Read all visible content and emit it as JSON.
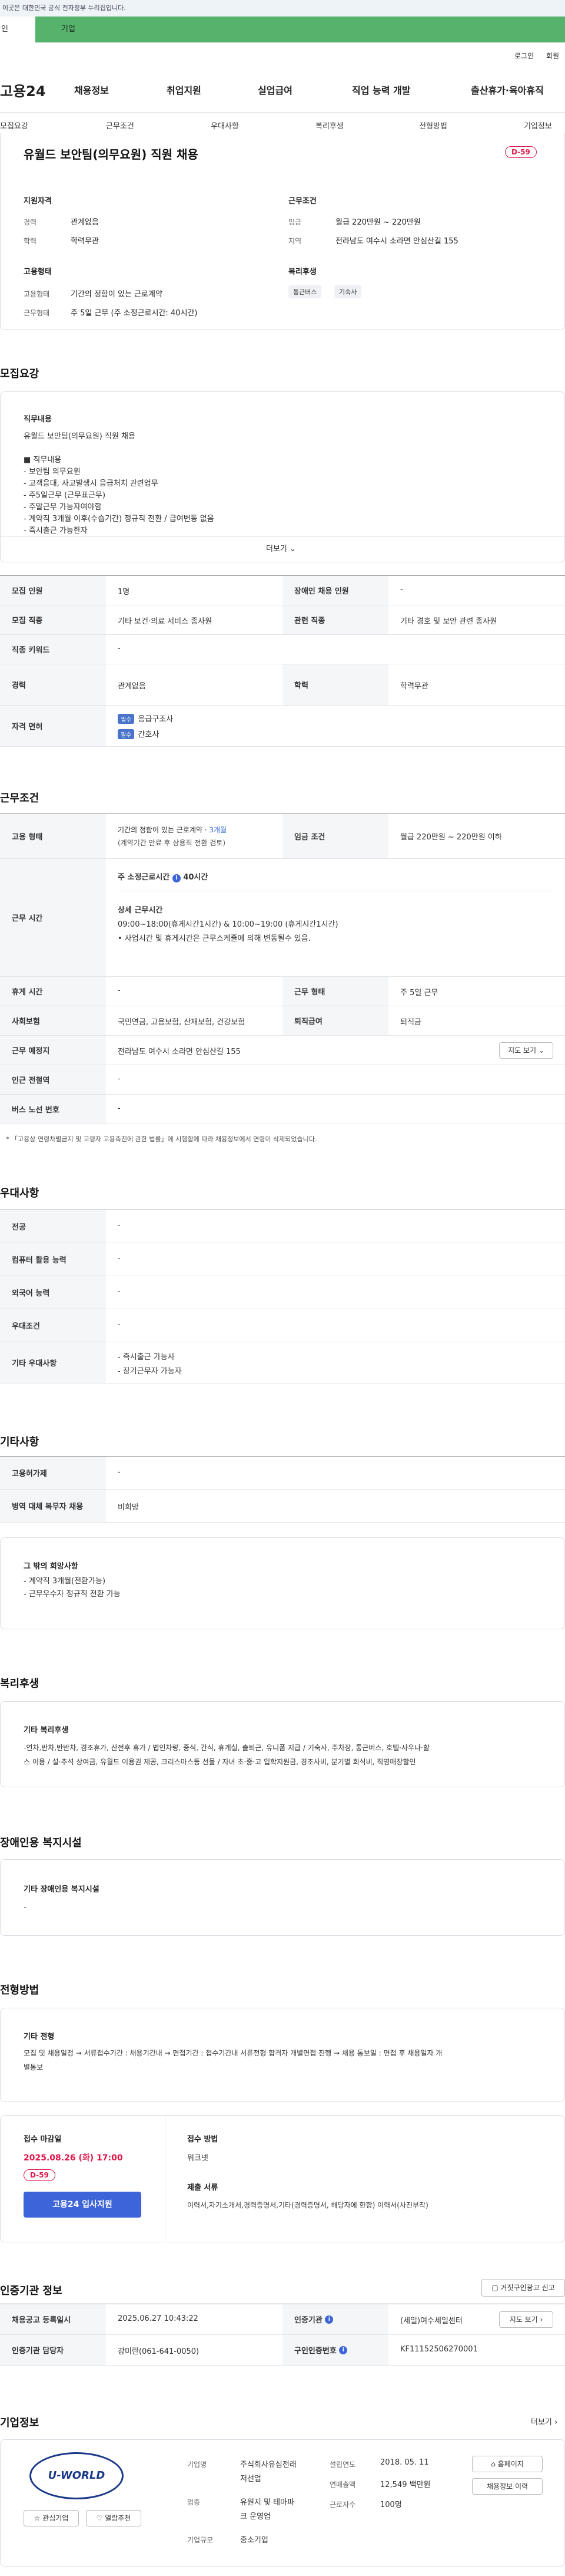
{
  "gov": "이곳은 대한민국 공식 전자정부 누리집입니다.",
  "tabs": [
    "인",
    "기업"
  ],
  "util": {
    "login": "로그인",
    "join": "회원"
  },
  "logo": "고용24",
  "gnb": [
    "채용정보",
    "취업지원",
    "실업급여",
    "직업 능력 개발",
    "출산휴가·육아휴직"
  ],
  "snb": [
    "모집요강",
    "근무조건",
    "우대사항",
    "복리후생",
    "전형방법",
    "기업정보"
  ],
  "job": {
    "title": "유월드 보안팀(의무요원) 직원 채용",
    "dday": "D-59",
    "qual_title": "지원자격",
    "career_k": "경력",
    "career_v": "관계없음",
    "edu_k": "학력",
    "edu_v": "학력무관",
    "emp_title": "고용형태",
    "emp_k": "고용형태",
    "emp_v": "기간의 정함이 있는 근로계약",
    "hours_k": "근무형태",
    "hours_v": "주 5일 근무 (주 소정근로시간: 40시간)",
    "cond_title": "근무조건",
    "wage_k": "임금",
    "wage_v": "월급 220만원 ~ 220만원",
    "area_k": "지역",
    "area_v": "전라남도 여수시 소라면 안심산길 155",
    "ben_title": "복리후생",
    "chips": [
      "통근버스",
      "기숙사"
    ]
  },
  "recruit": {
    "title": "모집요강",
    "box_title": "직무내용",
    "lines": [
      "유월드 보안팀(의무요원) 직원 채용",
      "",
      "■ 직무내용",
      "- 보안팀 의무요원",
      "- 고객응대, 사고발생시 응급처치 관련업무",
      "- 주5일근무 (근무표근무)",
      "- 주말근무 가능자여야함",
      "- 계약직 3개월 이후(수습기간) 정규직 전환 / 급여변동 없음",
      "- 즉시출근 가능한자"
    ],
    "more": "더보기"
  },
  "rtable": {
    "r1": [
      "모집 인원",
      "1명",
      "장애인 채용 인원",
      "-"
    ],
    "r2": [
      "모집 직종",
      "기타 보건·의료 서비스 종사원",
      "관련 직종",
      "기타 경호 및 보안 관련 종사원"
    ],
    "r3": [
      "직종 키워드",
      "-"
    ],
    "r4": [
      "경력",
      "관계없음",
      "학력",
      "학력무관"
    ],
    "r5": [
      "자격 면허"
    ],
    "tag": "필수",
    "lic": [
      "응급구조사",
      "간호사"
    ]
  },
  "work": {
    "title": "근무조건",
    "emp_k": "고용 형태",
    "emp_v": "기간의 정함이 있는 근로계약 · ",
    "emp_month": "3개월",
    "emp_v2": "(계약기간 만료 후 상용직 전환 검토)",
    "wage_k": "임금 조건",
    "wage_v": "월급 220만원 ~ 220만원 이하",
    "time_k": "근무 시간",
    "time_sub": "주 소정근로시간",
    "time_hours": "40시간",
    "detail_t": "상세 근무시간",
    "detail_v": "09:00~18:00(휴게시간1시간) & 10:00~19:00 (휴게시간1시간)",
    "note": "• 사업시간 및 휴게시간은 근무스케줄에 의해 변동될수 있음.",
    "rest_k": "휴게 시간",
    "rest_v": "-",
    "form_k": "근무 형태",
    "form_v": "주 5일 근무",
    "ins_k": "사회보험",
    "ins_v": "국민연금, 고용보험, 산재보험, 건강보험",
    "ret_k": "퇴직급여",
    "ret_v": "퇴직금",
    "loc_k": "근무 예정지",
    "loc_v": "전라남도 여수시 소라면 안심산길 155",
    "map": "지도 보기",
    "sta_k": "인근 전철역",
    "sta_v": "-",
    "bus_k": "버스 노선 번호",
    "bus_v": "-",
    "foot": "* 「고용상 연령차별금지 및 고령자 고용촉진에 관한 법률」에 시행함에 따라 채용정보에서 연령이 삭제되었습니다."
  },
  "pref": {
    "title": "우대사항",
    "rows": [
      [
        "전공",
        "-"
      ],
      [
        "컴퓨터 활용 능력",
        "-"
      ],
      [
        "외국어 능력",
        "-"
      ],
      [
        "우대조건",
        "-"
      ]
    ],
    "etc_k": "기타 우대사항",
    "etc_v": [
      "- 즉시출근 가능사",
      "- 장기근무자 가능자"
    ]
  },
  "other": {
    "title": "기타사항",
    "r1": [
      "고용허가제",
      "-"
    ],
    "r2": [
      "병역 대체 복무자 채용",
      "비희망"
    ],
    "box_t": "그 밖의 희망사항",
    "box_v": [
      "- 계약직 3개월(전환가능)",
      "- 근무우수자 정규직 전환 가능"
    ]
  },
  "welfare": {
    "title": "복리후생",
    "box_t": "기타 복리후생",
    "box_v": "-연차,반차,반반차, 경조휴가, 산전후 휴가 / 법인차량, 중식, 간식, 휴게실, 출퇴근, 유니폼 지급 / 기숙사, 주차장, 통근버스, 호텔·사우나·할",
    "box_v2": "스 이용 / 설·추석 상여금, 유월드 이용권 제공, 크리스마스등 선물 / 자녀 초·중·고 입학지원금, 경조사비, 분기별 회식비, 직영매장할인"
  },
  "disab": {
    "title": "장애인용 복지시설",
    "box_t": "기타 장애인용 복지시설",
    "box_v": "-"
  },
  "select": {
    "title": "전형방법",
    "box_t": "기타 전형",
    "box_v": "모집 및 채용일정 → 서류접수기간 : 채용기간내 → 면접기간 : 접수기간내 서류전형 합격자 개별면접 진행 → 채용 통보일 : 면접 후 채용일자 개",
    "box_v2": "별통보",
    "dl_t": "접수 마감일",
    "dl_v": "2025.08.26 (화) 17:00",
    "dday": "D-59",
    "apply": "고용24 입사지원",
    "how_t": "접수 방법",
    "how_v": "워크넷",
    "doc_t": "제출 서류",
    "doc_v": "이력서,자기소개서,경력증명서,기타(경력증명서, 해당자에 한함) 이력서(사진부착)"
  },
  "agency": {
    "title": "인증기관 정보",
    "btn": "거짓구인광고 신고",
    "r1": [
      "채용공고 등록일시",
      "2025.06.27 10:43:22",
      "인증기관",
      "(세일)여수세일센터"
    ],
    "map": "지도 보기",
    "r2": [
      "인증기관 담당자",
      "강미란(061-641-0050)",
      "구인인증번호",
      "KF11152506270001"
    ]
  },
  "company": {
    "title": "기업정보",
    "more": "더보기",
    "logo": "U-WORLD",
    "fav": "관심기업",
    "reco": "열람추천",
    "k1": "기업명",
    "v1": "주식회사유심전래",
    "v1b": "저선업",
    "k2": "업종",
    "v2": "유원지 및 테마파",
    "v2b": "크 운영업",
    "k3": "기업규모",
    "v3": "중소기업",
    "k4": "설립연도",
    "v4": "2018. 05. 11",
    "k5": "연매출액",
    "v5": "12,549 백만원",
    "k6": "근로자수",
    "v6": "100명",
    "b1": "홈페이지",
    "b2": "채용정보 이력"
  },
  "colors": {
    "green": "#56b36b",
    "red": "#e0194b",
    "blue": "#3e64d9"
  }
}
